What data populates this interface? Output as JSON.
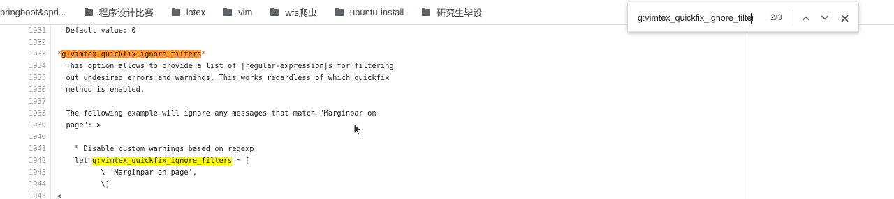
{
  "bookmarks": [
    {
      "label": "pringboot&spri...",
      "type": "page"
    },
    {
      "label": "程序设计比赛",
      "type": "folder"
    },
    {
      "label": "latex",
      "type": "folder"
    },
    {
      "label": "vim",
      "type": "folder"
    },
    {
      "label": "wfs爬虫",
      "type": "folder"
    },
    {
      "label": "ubuntu-install",
      "type": "folder"
    },
    {
      "label": "研究生毕设",
      "type": "folder"
    }
  ],
  "find_bar": {
    "query": "g:vimtex_quickfix_ignore_filters",
    "match_count": "2/3",
    "icons": {
      "prev": "chevron-up-icon",
      "next": "chevron-down-icon",
      "close": "close-icon"
    }
  },
  "highlight_colors": {
    "active_match": "#ff9632",
    "other_match": "#ffff00"
  },
  "source_lines": [
    {
      "num": "1931",
      "text": "  Default value: 0"
    },
    {
      "num": "1932",
      "text": ""
    },
    {
      "num": "1933",
      "pre": "*",
      "match": "g:vimtex_quickfix_ignore_filters",
      "post": "*",
      "match_style": "active"
    },
    {
      "num": "1934",
      "text": "  This option allows to provide a list of |regular-expression|s for filtering"
    },
    {
      "num": "1935",
      "text": "  out undesired errors and warnings. This works regardless of which quickfix"
    },
    {
      "num": "1936",
      "text": "  method is enabled."
    },
    {
      "num": "1937",
      "text": ""
    },
    {
      "num": "1938",
      "text": "  The following example will ignore any messages that match \"Marginpar on"
    },
    {
      "num": "1939",
      "text": "  page\": >"
    },
    {
      "num": "1940",
      "text": ""
    },
    {
      "num": "1941",
      "text": "    \" Disable custom warnings based on regexp"
    },
    {
      "num": "1942",
      "pre": "    let ",
      "match": "g:vimtex_quickfix_ignore_filters",
      "post": " = [",
      "match_style": "other"
    },
    {
      "num": "1943",
      "text": "          \\ 'Marginpar on page',"
    },
    {
      "num": "1944",
      "text": "          \\]"
    },
    {
      "num": "1945",
      "text": "<"
    }
  ]
}
